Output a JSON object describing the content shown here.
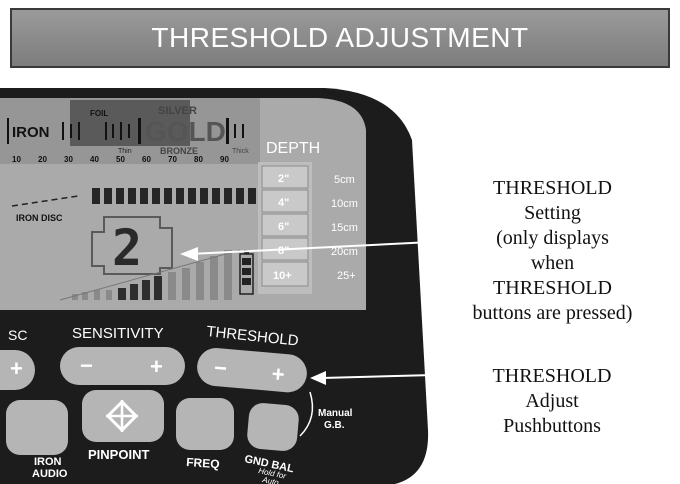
{
  "title": "THRESHOLD ADJUSTMENT",
  "display": {
    "top_labels": {
      "iron": "IRON",
      "foil": "FOIL",
      "silver": "SILVER",
      "gold": "GOLD",
      "bronze": "BRONZE",
      "thin": "Thin",
      "thick": "Thick"
    },
    "scale": [
      "10",
      "20",
      "30",
      "40",
      "50",
      "60",
      "70",
      "80",
      "90"
    ],
    "iron_disc": "IRON DISC",
    "digit": "2",
    "depth_title": "DEPTH",
    "depth_inches": [
      "2\"",
      "4\"",
      "6\"",
      "8\"",
      "10+"
    ],
    "depth_cm": [
      "5cm",
      "10cm",
      "15cm",
      "20cm",
      "25+"
    ]
  },
  "controls": {
    "disc": "SC",
    "sensitivity": "SENSITIVITY",
    "threshold": "THRESHOLD",
    "minus": "−",
    "plus": "+",
    "iron_audio_1": "IRON",
    "iron_audio_2": "AUDIO",
    "pinpoint": "PINPOINT",
    "freq": "FREQ",
    "gnd_bal": "GND BAL",
    "gnd_hold_1": "Hold for",
    "gnd_hold_2": "Auto",
    "manual_1": "Manual",
    "manual_2": "G.B."
  },
  "callouts": {
    "setting": [
      "THRESHOLD",
      "Setting",
      "(only displays",
      "when",
      "THRESHOLD",
      "buttons are pressed)"
    ],
    "adjust": [
      "THRESHOLD",
      "Adjust",
      "Pushbuttons"
    ]
  }
}
